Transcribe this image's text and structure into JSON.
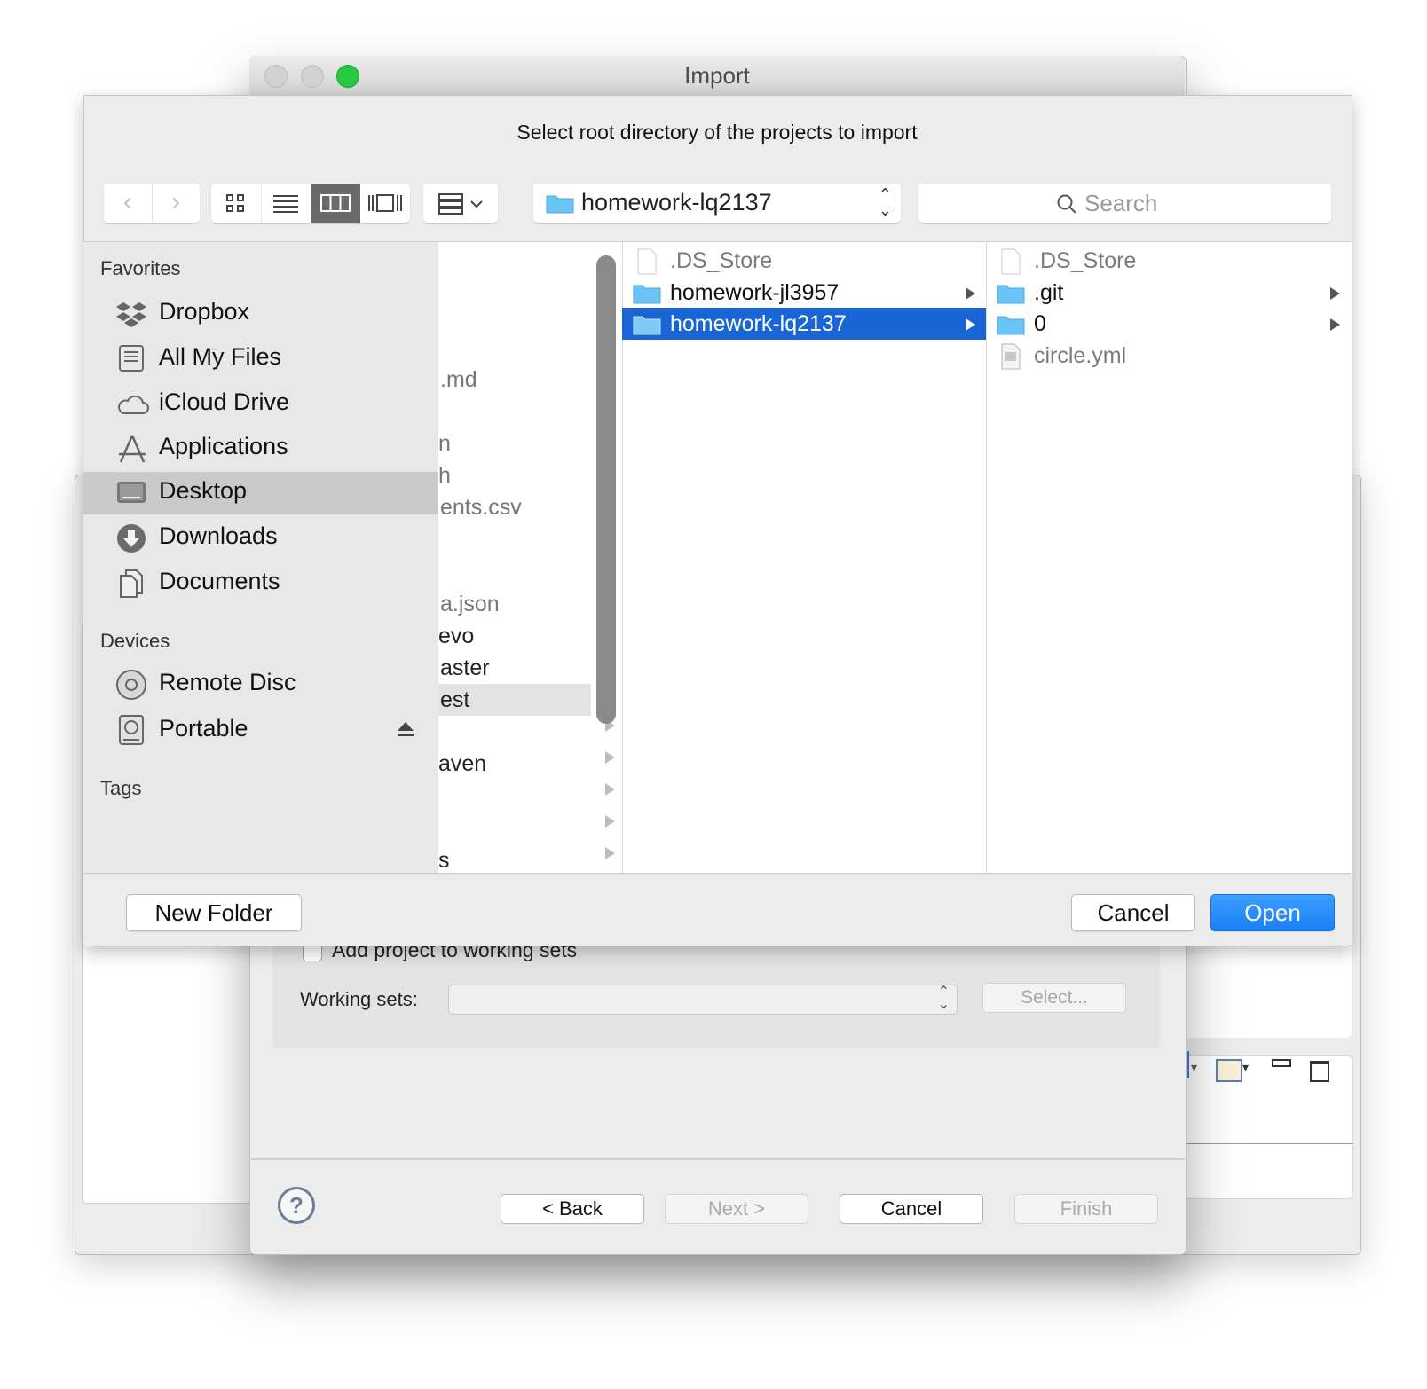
{
  "import_dialog": {
    "title": "Import",
    "working_sets": {
      "checkbox_label": "Add project to working sets",
      "label": "Working sets:",
      "select_value": "",
      "select_button": "Select..."
    },
    "buttons": {
      "back": "< Back",
      "next": "Next >",
      "cancel": "Cancel",
      "finish": "Finish"
    },
    "help": "?"
  },
  "open_panel": {
    "prompt": "Select root directory of the projects to import",
    "path": "homework-lq2137",
    "search_placeholder": "Search",
    "sidebar": {
      "favorites_heading": "Favorites",
      "favorites": [
        "Dropbox",
        "All My Files",
        "iCloud Drive",
        "Applications",
        "Desktop",
        "Downloads",
        "Documents"
      ],
      "selected": "Desktop",
      "devices_heading": "Devices",
      "devices": [
        "Remote Disc",
        "Portable"
      ],
      "tags_heading": "Tags"
    },
    "column1": [
      ".md",
      "n",
      "h",
      "ents.csv",
      "a.json",
      "evo",
      "aster",
      "est",
      "aven",
      "s"
    ],
    "column2": [
      {
        "name": ".DS_Store",
        "kind": "file"
      },
      {
        "name": "homework-jl3957",
        "kind": "folder"
      },
      {
        "name": "homework-lq2137",
        "kind": "folder",
        "selected": true
      }
    ],
    "column3": [
      {
        "name": ".DS_Store",
        "kind": "file"
      },
      {
        "name": ".git",
        "kind": "folder"
      },
      {
        "name": "0",
        "kind": "folder"
      },
      {
        "name": "circle.yml",
        "kind": "file"
      }
    ],
    "buttons": {
      "new_folder": "New Folder",
      "cancel": "Cancel",
      "open": "Open"
    }
  },
  "colors": {
    "selection": "#1a65d6",
    "open_button": "#1a7ef5",
    "folder": "#6cc3f5",
    "green_light": "#28c840"
  }
}
